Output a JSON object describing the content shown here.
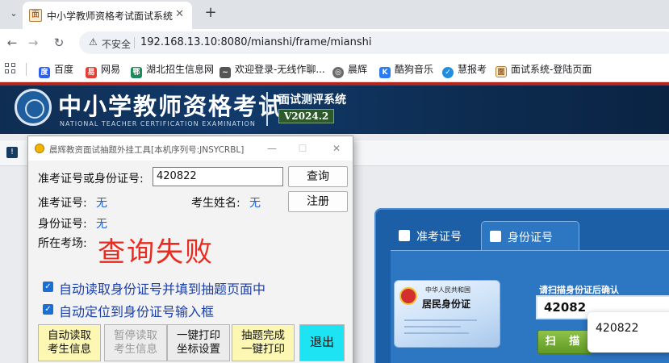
{
  "browser": {
    "tab_title": "中小学教师资格考试面试系统",
    "tab_close": "✕",
    "new_tab": "+",
    "tab_menu": "⌄",
    "security_label": "不安全",
    "url": "192.168.13.10:8080/mianshi/frame/mianshi",
    "bookmarks": [
      {
        "label": "百度",
        "icon": "baidu-icon",
        "color": "#2f5ff0"
      },
      {
        "label": "网易",
        "icon": "netease-icon",
        "color": "#e63e32"
      },
      {
        "label": "湖北招生信息网",
        "icon": "hubei-icon",
        "color": "#1c8a5a"
      },
      {
        "label": "欢迎登录-无线作聊...",
        "icon": "wireless-icon",
        "color": "#555555"
      },
      {
        "label": "晨辉",
        "icon": "chenhui-icon",
        "color": "#6b6b6b"
      },
      {
        "label": "酷狗音乐",
        "icon": "kugou-icon",
        "color": "#2a7cf0"
      },
      {
        "label": "慧报考",
        "icon": "huibaokao-icon",
        "color": "#1f8de0"
      },
      {
        "label": "面试系统-登陆页面",
        "icon": "interview-system-icon",
        "color": "#b07d3a"
      }
    ]
  },
  "banner": {
    "title": "中小学教师资格考试",
    "subtitle": "NATIONAL TEACHER CERTIFICATION EXAMINATION",
    "system_name": "面试测评系统",
    "version": "V2024.2"
  },
  "exam_panel": {
    "tabs": [
      "准考证号",
      "身份证号"
    ],
    "active_tab": 1,
    "idcard_line1": "中华人民共和国",
    "idcard_line2": "居民身份证",
    "scan_hint": "请扫描身份证后确认",
    "scan_value": "42082",
    "scan_button": "扫 描",
    "autocomplete_value": "420822"
  },
  "tool_dialog": {
    "title": "晨辉教资面试抽题外挂工具[本机序列号:JNSYCRBL]",
    "minimize": "—",
    "maximize": "☐",
    "close": "✕",
    "query_label": "准考证号或身份证号:",
    "query_value": "420822",
    "query_button": "查询",
    "register_button": "注册",
    "ticket_label": "准考证号:",
    "ticket_value": "无",
    "name_label": "考生姓名:",
    "name_value": "无",
    "id_label": "身份证号:",
    "id_value": "无",
    "location_label": "所在考场:",
    "status_message": "查询失败",
    "checkbox1": "自动读取身份证号并填到抽题页面中",
    "checkbox2": "自动定位到身份证号输入框",
    "btn_auto_read_1": "自动读取",
    "btn_auto_read_2": "考生信息",
    "btn_pause_1": "暂停读取",
    "btn_pause_2": "考生信息",
    "btn_print_setup_1": "一键打印",
    "btn_print_setup_2": "坐标设置",
    "btn_finish_print_1": "抽题完成",
    "btn_finish_print_2": "一键打印",
    "btn_exit": "退出"
  }
}
